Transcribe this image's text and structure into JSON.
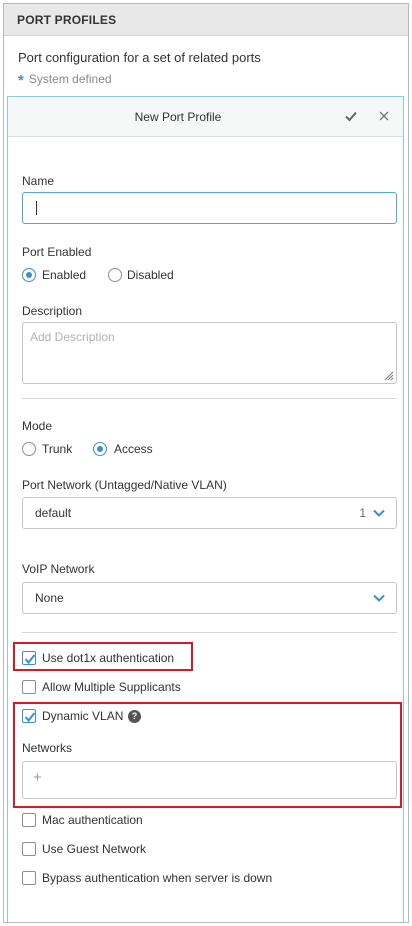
{
  "header": {
    "title": "PORT PROFILES"
  },
  "intro": {
    "description": "Port configuration for a set of related ports",
    "system_defined": "System defined"
  },
  "panel": {
    "title": "New Port Profile",
    "name_label": "Name",
    "name_value": "",
    "port_enabled_label": "Port Enabled",
    "enabled_option": "Enabled",
    "disabled_option": "Disabled",
    "description_label": "Description",
    "description_placeholder": "Add Description",
    "mode_label": "Mode",
    "trunk_option": "Trunk",
    "access_option": "Access",
    "port_network_label": "Port Network (Untagged/Native VLAN)",
    "port_network_value": "default",
    "port_network_vlan": "1",
    "voip_label": "VoIP Network",
    "voip_value": "None",
    "dot1x_label": "Use dot1x authentication",
    "multi_supplicants_label": "Allow Multiple Supplicants",
    "dynamic_vlan_label": "Dynamic VLAN",
    "networks_label": "Networks",
    "networks_add": "+",
    "mac_auth_label": "Mac authentication",
    "guest_network_label": "Use Guest Network",
    "bypass_label": "Bypass authentication when server is down"
  },
  "state": {
    "port_enabled": "Enabled",
    "mode": "Access",
    "use_dot1x": true,
    "allow_multiple_supplicants": false,
    "dynamic_vlan": true,
    "mac_authentication": false,
    "use_guest_network": false,
    "bypass_auth": false
  },
  "colors": {
    "accent": "#3a8fd1",
    "highlight": "#d11b2b",
    "header_bg": "#e8e8e8"
  },
  "icons": [
    "star-icon",
    "checkmark-icon",
    "close-icon",
    "chevron-down-icon",
    "help-icon",
    "plus-icon",
    "resize-grip-icon"
  ]
}
